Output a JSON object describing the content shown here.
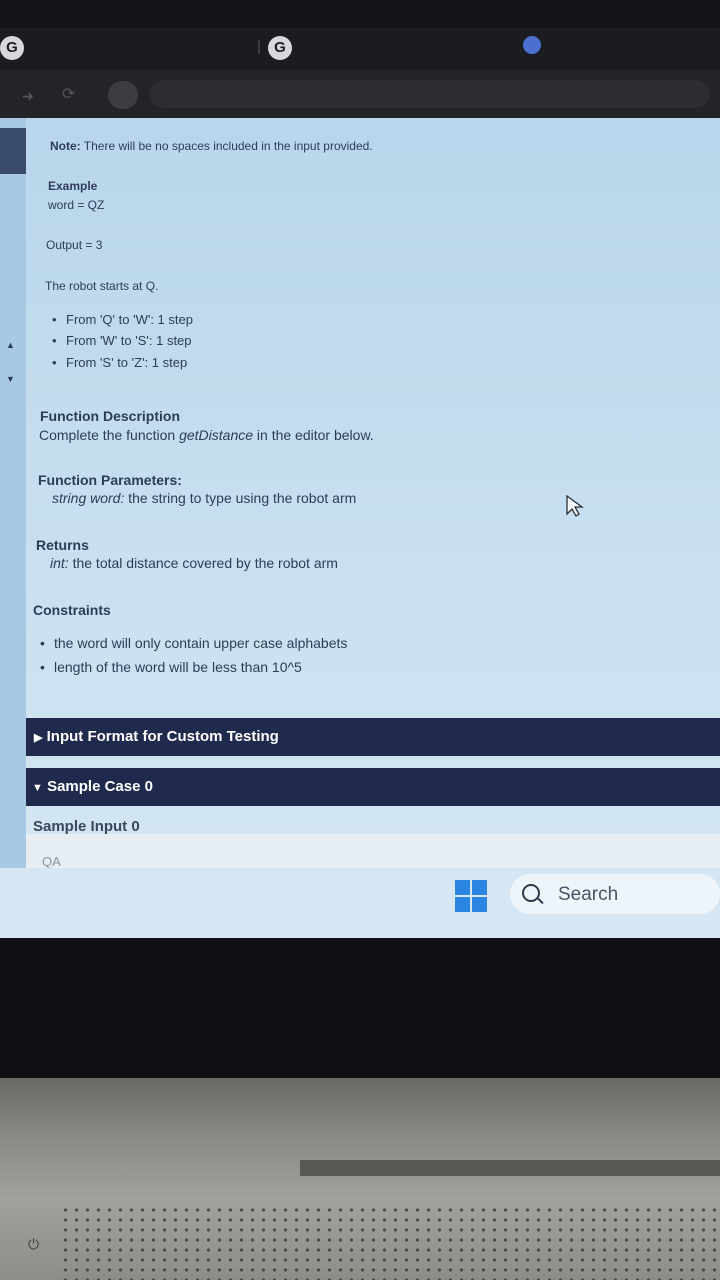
{
  "browser": {
    "tab_icon_letter": "G"
  },
  "problem": {
    "note_label": "Note:",
    "note_text": "There will be no spaces included in the input provided.",
    "example_heading": "Example",
    "example_word": "word = QZ",
    "output_line": "Output = 3",
    "start_text": "The robot starts at Q.",
    "steps": [
      "From 'Q' to 'W': 1 step",
      "From 'W' to 'S': 1 step",
      "From 'S' to 'Z': 1 step"
    ],
    "function_description_heading": "Function Description",
    "function_description_prefix": "Complete the function",
    "function_name": "getDistance",
    "function_description_suffix": "in the editor below.",
    "parameters_heading": "Function Parameters:",
    "param_type": "string word:",
    "param_desc": "the string to type using the robot arm",
    "returns_heading": "Returns",
    "returns_type": "int:",
    "returns_desc": "the total distance covered by the robot arm",
    "constraints_heading": "Constraints",
    "constraints": [
      "the word will only contain upper case alphabets",
      "length of the word will be less than 10^5"
    ],
    "input_format_label": "Input Format for Custom Testing",
    "sample_case_label": "Sample Case 0",
    "sample_input_heading": "Sample Input 0",
    "sample_input_value": "QA"
  },
  "taskbar": {
    "search_label": "Search",
    "start_icon": "windows-logo-icon"
  }
}
